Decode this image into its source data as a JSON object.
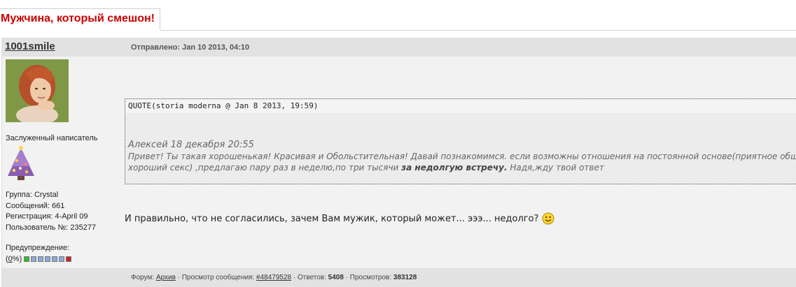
{
  "topic": {
    "title": "Мужчина, который смешон!"
  },
  "post": {
    "author": "1001smile",
    "posted": "Отправлено: Jan 10 2013, 04:10",
    "rank": "Заслуженный написатель",
    "info": {
      "group": "Группа: Crystal",
      "messages": "Сообщений: 661",
      "registered": "Регистрация: 4-April 09",
      "user_no": "Пользователь №: 235277"
    },
    "warning": {
      "label": "Предупреждение:",
      "open": "(",
      "percent": "0",
      "close": "%)",
      "boxes": [
        "#33bb33",
        "#8eaadd",
        "#8eaadd",
        "#8eaadd",
        "#8eaadd",
        "#8eaadd",
        "#cc2222"
      ]
    },
    "quote": {
      "header": "QUOTE(storia moderna @ Jan 8 2013, 19:59)",
      "line1": "Алексей 18 декабря 20:55",
      "line2": "Привет! Ты такая хорошенькая! Красивая и Обольстительная! Давай познакомимся. если возможны отношения на постоянной основе(приятное общ",
      "line3_a": "хороший секс) ,предлагаю пару раз в неделю,по три тысячи ",
      "line3_bold": "за недолгую встречу.",
      "line3_b": " Надя,жду твой ответ"
    },
    "text": "И правильно, что не согласились, зачем Вам мужик, который может... эээ... недолго?",
    "smiley_icon": "smiley-icon"
  },
  "footer": {
    "forum_label": "Форум: ",
    "forum_link": "Архив",
    "view_label": " · Просмотр сообщения: ",
    "view_link": "#48479528",
    "replies_label": " · Ответов: ",
    "replies": "5408",
    "views_label": " · Просмотров: ",
    "views": "383128"
  }
}
